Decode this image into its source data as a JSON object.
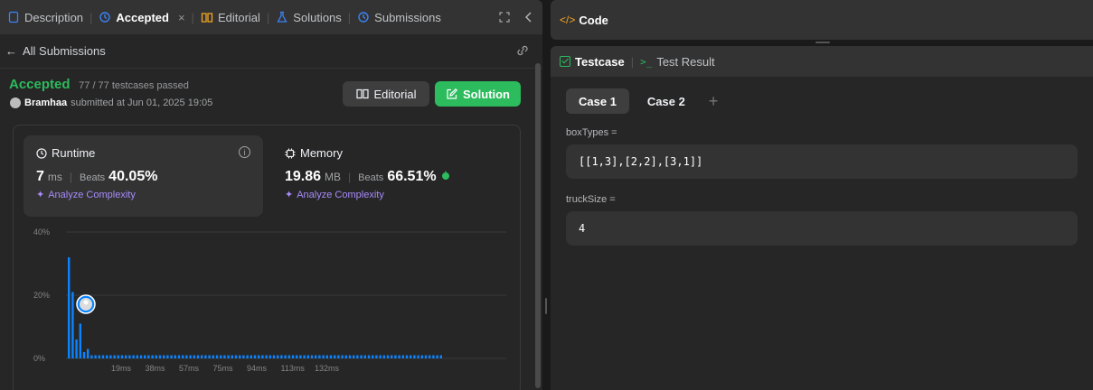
{
  "left_tabs": {
    "description": "Description",
    "accepted": "Accepted",
    "editorial": "Editorial",
    "solutions": "Solutions",
    "submissions": "Submissions"
  },
  "subbar": {
    "back_label": "All Submissions"
  },
  "submission": {
    "status": "Accepted",
    "testcases": "77 / 77 testcases passed",
    "user": "Bramhaa",
    "submitted_text": "submitted at Jun 01, 2025 19:05"
  },
  "buttons": {
    "editorial": "Editorial",
    "solution": "Solution"
  },
  "runtime": {
    "title": "Runtime",
    "value": "7",
    "unit": "ms",
    "beats_label": "Beats",
    "beats_value": "40.05%",
    "analyze": "Analyze Complexity"
  },
  "memory": {
    "title": "Memory",
    "value": "19.86",
    "unit": "MB",
    "beats_label": "Beats",
    "beats_value": "66.51%",
    "analyze": "Analyze Complexity"
  },
  "chart_data": {
    "type": "bar",
    "y_ticks": [
      "40%",
      "20%",
      "0%"
    ],
    "ylim": [
      0,
      40
    ],
    "x_ticks": [
      "19ms",
      "38ms",
      "57ms",
      "75ms",
      "94ms",
      "113ms",
      "132ms"
    ],
    "values": [
      32,
      21,
      6,
      11,
      2,
      3,
      1,
      1,
      1,
      1,
      1,
      1,
      1,
      1,
      1,
      1,
      1,
      1,
      1,
      1,
      1,
      1,
      1,
      1,
      1,
      1,
      1,
      1,
      1,
      1,
      1,
      1,
      1,
      1,
      1,
      1,
      1,
      1,
      1,
      1,
      1,
      1,
      1,
      1,
      1,
      1,
      1,
      1,
      1,
      1,
      1,
      1,
      1,
      1,
      1,
      1,
      1,
      1,
      1,
      1,
      1,
      1,
      1,
      1,
      1,
      1,
      1,
      1,
      1,
      1,
      1,
      1,
      1,
      1,
      1,
      1,
      1,
      1,
      1,
      1,
      1,
      1,
      1,
      1,
      1,
      1,
      1,
      1,
      1,
      1,
      1,
      1,
      1,
      1,
      1,
      1,
      1,
      1,
      1
    ],
    "bar_color": "#0a84ff",
    "grid": true
  },
  "code_panel": {
    "title": "Code"
  },
  "testcase_tabs": {
    "testcase": "Testcase",
    "result": "Test Result"
  },
  "cases": {
    "case1": "Case 1",
    "case2": "Case 2"
  },
  "fields": {
    "box_label": "boxTypes =",
    "box_value": "[[1,3],[2,2],[3,1]]",
    "truck_label": "truckSize =",
    "truck_value": "4"
  },
  "colors": {
    "accepted": "#2cbb5d",
    "accent_purple": "#a78bfa",
    "bar": "#0a84ff"
  }
}
